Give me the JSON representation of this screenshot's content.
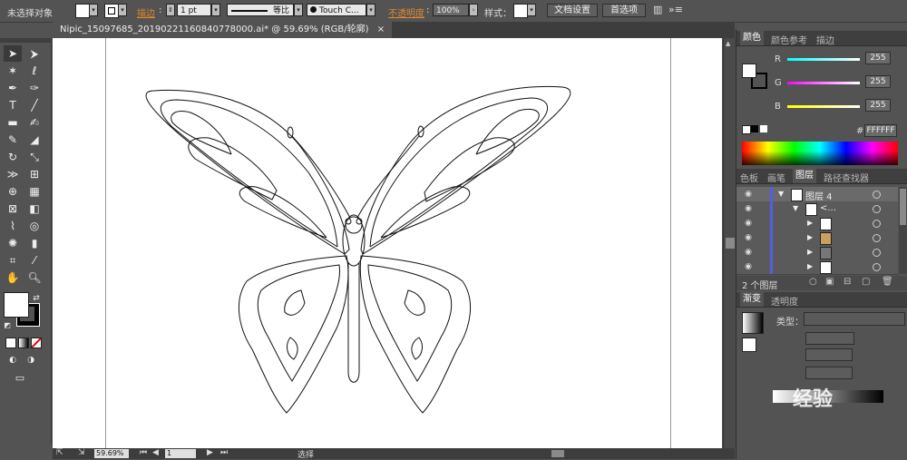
{
  "control_bar": {
    "selection_status": "未选择对象",
    "stroke_label": "描边",
    "stroke_weight": "1 pt",
    "profile_label": "等比",
    "brush_label": "Touch C...",
    "opacity_label": "不透明度",
    "opacity_value": "100%",
    "style_label": "样式：",
    "doc_setup_button": "文档设置",
    "preferences_button": "首选项"
  },
  "document": {
    "tab_title": "Nipic_15097685_20190221160840778000.ai* @ 59.69% (RGB/轮廓)",
    "close_glyph": "×"
  },
  "status_bar": {
    "zoom": "59.69%",
    "artboard": "1",
    "tool_name": "选择"
  },
  "color_panel": {
    "tabs": [
      "颜色",
      "颜色参考",
      "描边"
    ],
    "r_label": "R",
    "g_label": "G",
    "b_label": "B",
    "r_value": "255",
    "g_value": "255",
    "b_value": "255",
    "hex_label": "#",
    "hex_value": "FFFFFF"
  },
  "layers_panel": {
    "tabs": [
      "色板",
      "画笔",
      "图层",
      "路径查找器"
    ],
    "rows": [
      {
        "name": "图层 4"
      },
      {
        "name": "<..."
      },
      {
        "name": ""
      },
      {
        "name": ""
      },
      {
        "name": ""
      },
      {
        "name": ""
      }
    ],
    "footer_count": "2 个图层"
  },
  "gradient_panel": {
    "tabs": [
      "渐变",
      "透明度"
    ],
    "type_label": "类型："
  },
  "watermark": "经验",
  "colors": {
    "accent_orange": "#e08a2c",
    "layer_bar": "#5060e0",
    "panel_bg": "#535353"
  },
  "icons": [
    "selection-tool-icon",
    "direct-selection-icon",
    "magic-wand-icon",
    "lasso-icon",
    "pen-icon",
    "curvature-icon",
    "type-icon",
    "line-icon",
    "rectangle-icon",
    "paintbrush-icon",
    "pencil-icon",
    "eraser-icon",
    "rotate-icon",
    "scale-icon",
    "width-icon",
    "free-transform-icon",
    "shape-builder-icon",
    "perspective-icon",
    "mesh-icon",
    "gradient-icon",
    "eyedropper-icon",
    "blend-icon",
    "symbol-sprayer-icon",
    "graph-icon",
    "artboard-icon",
    "slice-icon",
    "hand-icon",
    "zoom-icon"
  ]
}
